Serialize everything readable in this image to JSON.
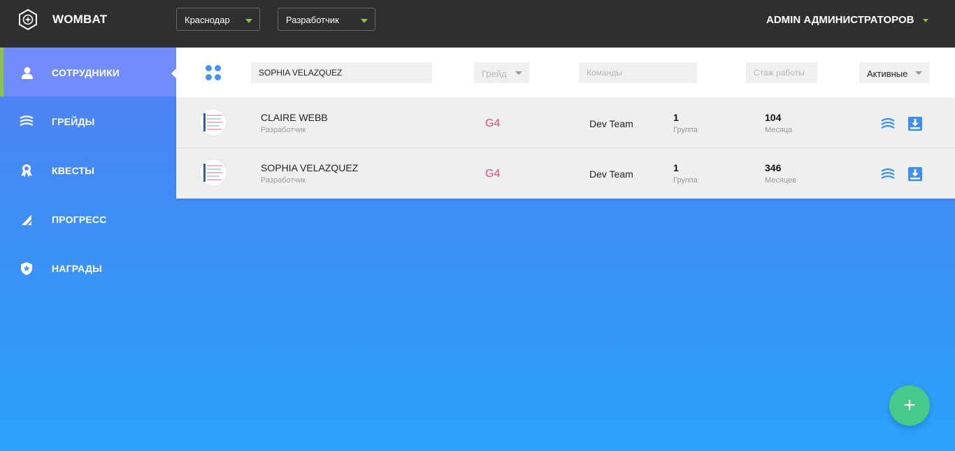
{
  "app": {
    "brand": "WOMBAT"
  },
  "header": {
    "city_select": "Краснодар",
    "role_select": "Разработчик",
    "user_menu": "ADMIN АДМИНИСТРАТОРОВ"
  },
  "sidebar": {
    "items": [
      {
        "label": "СОТРУДНИКИ",
        "icon": "user-icon",
        "active": true
      },
      {
        "label": "ГРЕЙДЫ",
        "icon": "layers-icon",
        "active": false
      },
      {
        "label": "КВЕСТЫ",
        "icon": "award-icon",
        "active": false
      },
      {
        "label": "ПРОГРЕСС",
        "icon": "signal-icon",
        "active": false
      },
      {
        "label": "НАГРАДЫ",
        "icon": "shield-star-icon",
        "active": false
      }
    ]
  },
  "filters": {
    "search_value": "SOPHIA VELAZQUEZ",
    "grade_placeholder": "Грейд",
    "teams_placeholder": "Команды",
    "experience_placeholder": "Стаж работы",
    "status_value": "Активные"
  },
  "employees": [
    {
      "name": "CLAIRE WEBB",
      "role": "Разработчик",
      "grade": "G4",
      "team": "Dev Team",
      "group_value": "1",
      "group_label": "Группа",
      "experience_value": "104",
      "experience_label": "Месяца"
    },
    {
      "name": "SOPHIA VELAZQUEZ",
      "role": "Разработчик",
      "grade": "G4",
      "team": "Dev Team",
      "group_value": "1",
      "group_label": "Группа",
      "experience_value": "346",
      "experience_label": "Месяцев"
    }
  ],
  "fab": {
    "label": "+"
  },
  "colors": {
    "accent_green": "#8bc34a",
    "grade_pink": "#e2467c",
    "action_blue": "#3a8ff0",
    "fab_green": "#47c98a",
    "topbar": "#2f2f2f"
  }
}
